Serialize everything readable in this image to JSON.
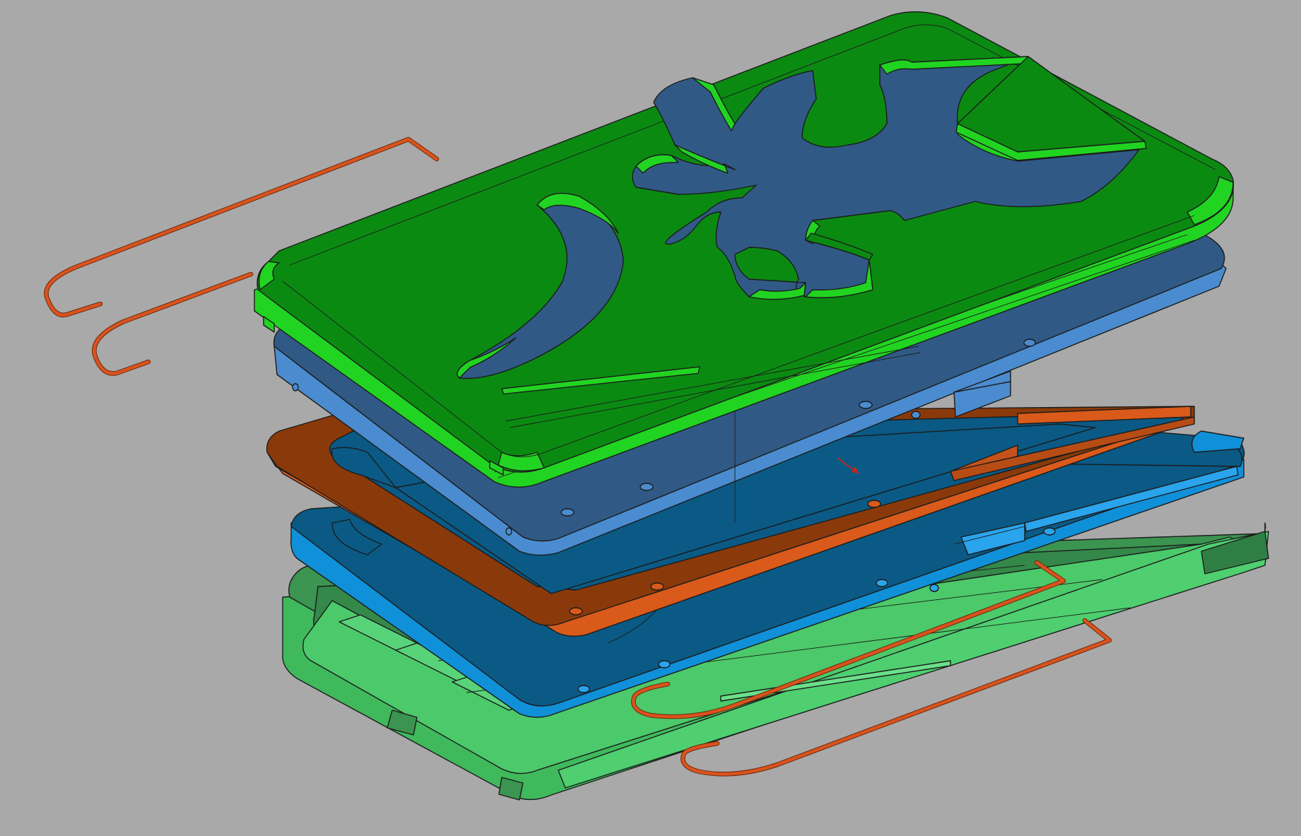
{
  "viewport": {
    "background_color": "#a9a9a9",
    "view": "isometric",
    "render_mode": "shaded-with-edges"
  },
  "model": {
    "description_visible": false,
    "parts": [
      {
        "id": "top-cover",
        "color": "#0b8a12",
        "rim_color": "#21d421",
        "feature": "tree-cutout"
      },
      {
        "id": "upper-plate",
        "color": "#305a85",
        "rim_color": "#4a8ccf"
      },
      {
        "id": "gasket-frame",
        "color": "#8a3a0a",
        "rim_color": "#d95a1a"
      },
      {
        "id": "middle-plate",
        "color": "#0a5a85",
        "rim_color": "#1090d8"
      },
      {
        "id": "bottom-tray",
        "color": "#34884a",
        "rim_color": "#4cc96a"
      },
      {
        "id": "hook-wire-1",
        "color": "#d9531e"
      },
      {
        "id": "hook-wire-2",
        "color": "#d9531e"
      },
      {
        "id": "hook-wire-3",
        "color": "#d9531e"
      },
      {
        "id": "hook-wire-4",
        "color": "#d9531e"
      }
    ]
  },
  "colors": {
    "edge": "#1b1b1b",
    "wire": "#d9531e",
    "triad_arrow": "#c0281c"
  }
}
